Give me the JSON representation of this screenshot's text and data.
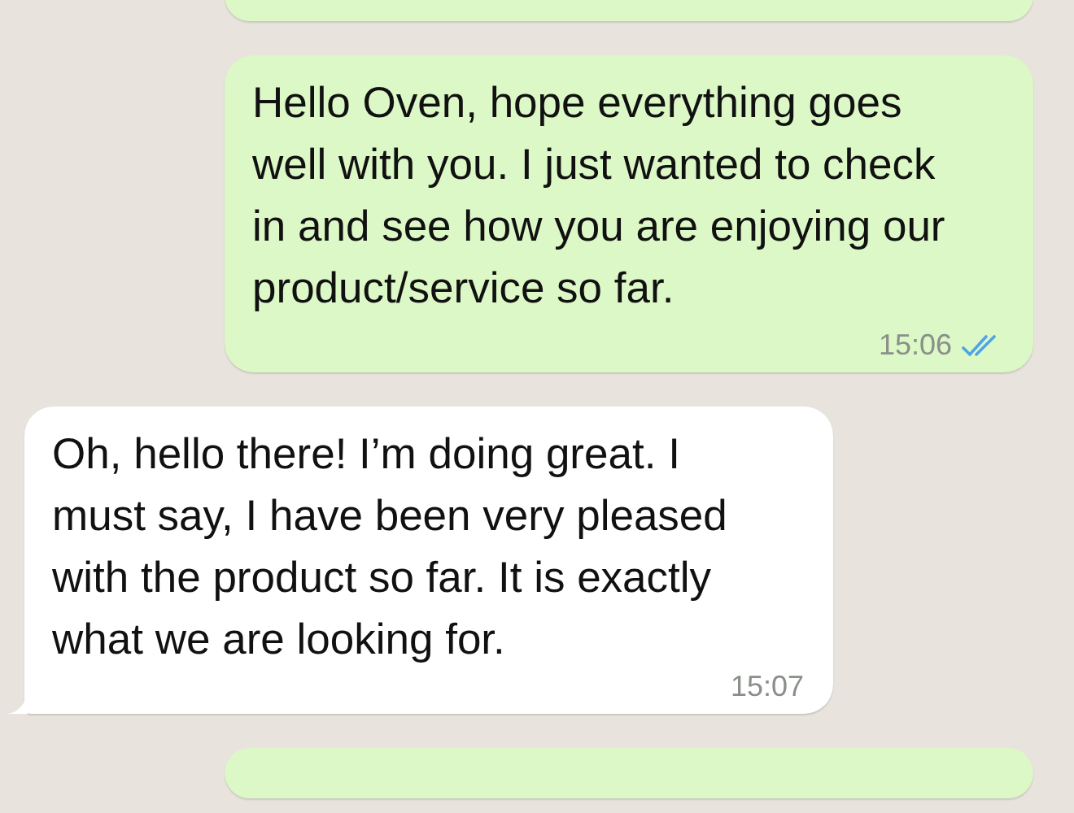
{
  "messages": [
    {
      "kind": "outgoing",
      "clipped": true
    },
    {
      "kind": "outgoing",
      "text": "Hello Oven, hope everything goes well with you. I just wanted to check in and see how you are enjoying our product/service so far.",
      "time": "15:06",
      "read": true
    },
    {
      "kind": "incoming",
      "text": "Oh, hello there! I’m doing great. I must say, I have been very pleased with the product so far. It is exactly what we are looking for.",
      "time": "15:07"
    },
    {
      "kind": "outgoing",
      "clipped": true
    }
  ]
}
